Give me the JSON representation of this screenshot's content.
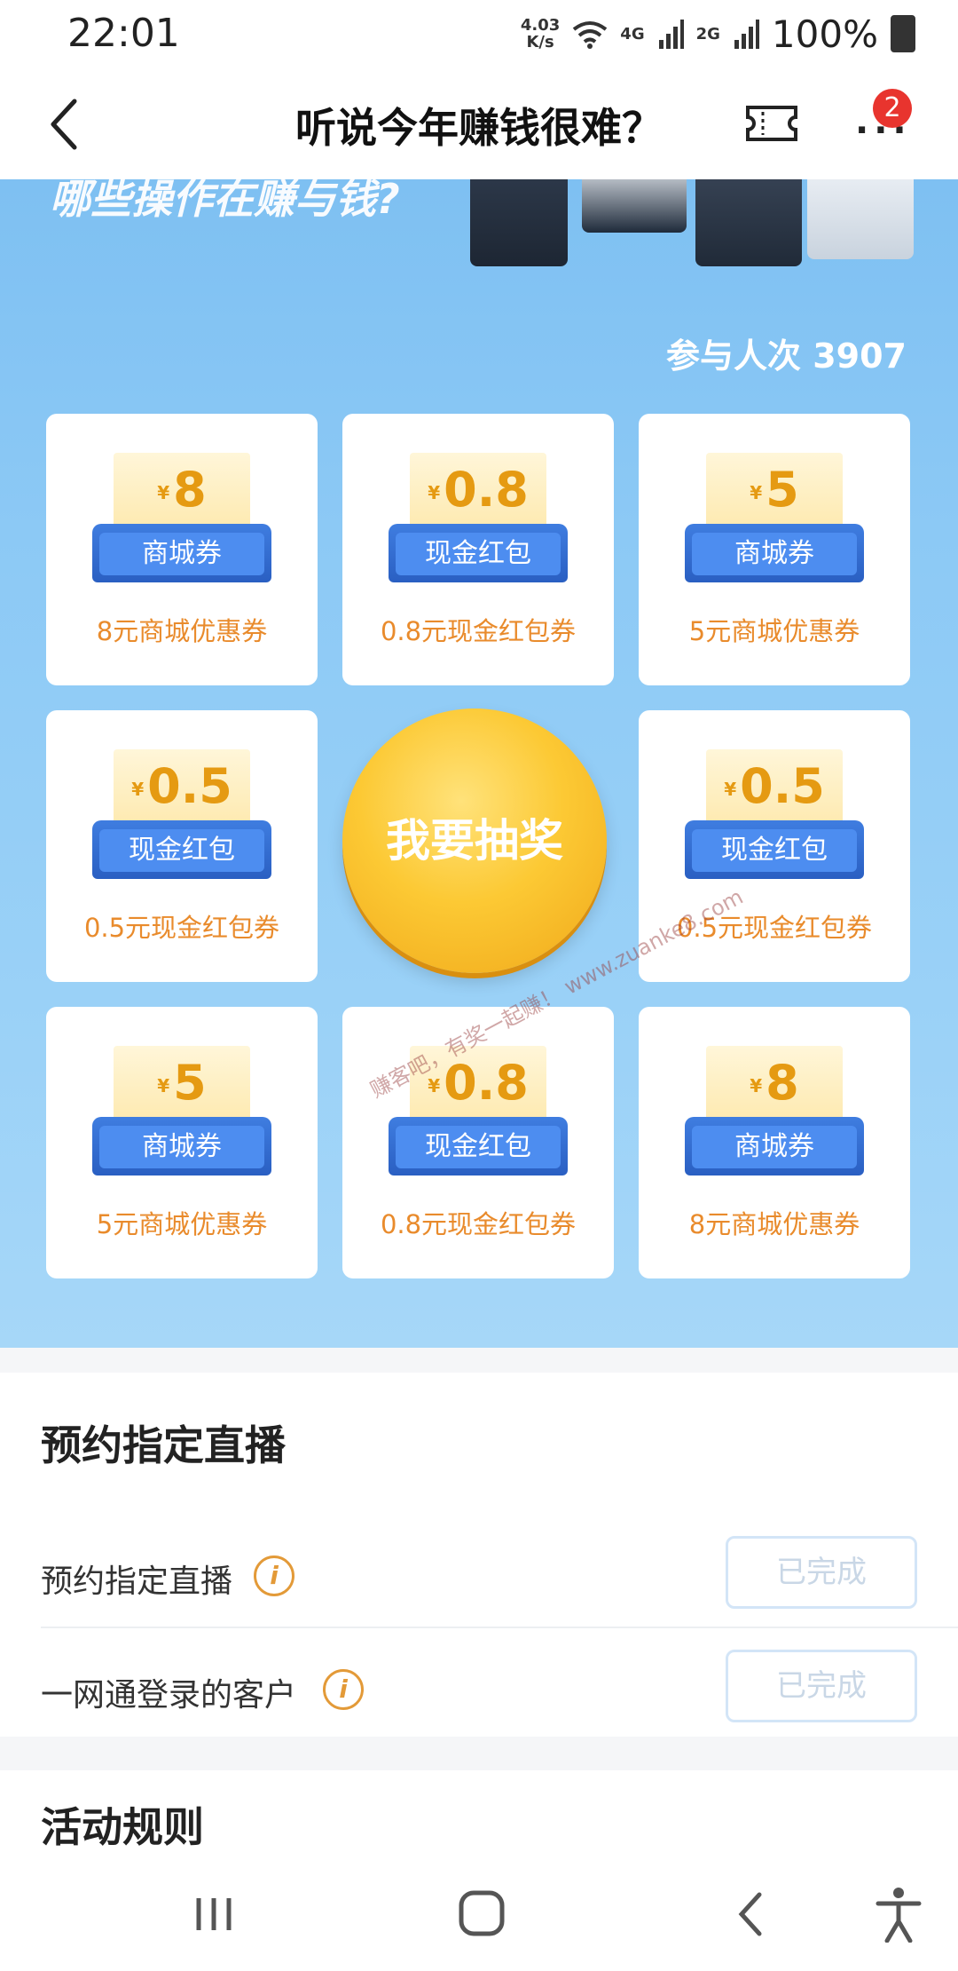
{
  "status_bar": {
    "time": "22:01",
    "net_speed_value": "4.03",
    "net_speed_unit": "K/s",
    "signal_1": "4G",
    "signal_2": "2G",
    "battery": "100%"
  },
  "header": {
    "title": "听说今年赚钱很难？",
    "notification_count": "2"
  },
  "banner": {
    "headline": "哪些操作在赚与钱?",
    "participants": "参与人次 3907"
  },
  "prizes": [
    {
      "amount": "8",
      "coupon_label": "商城券",
      "name": "8元商城优惠券"
    },
    {
      "amount": "0.8",
      "coupon_label": "现金红包",
      "name": "0.8元现金红包券"
    },
    {
      "amount": "5",
      "coupon_label": "商城券",
      "name": "5元商城优惠券"
    },
    {
      "amount": "0.5",
      "coupon_label": "现金红包",
      "name": "0.5元现金红包券"
    },
    {
      "amount": "0.5",
      "coupon_label": "现金红包",
      "name": "0.5元现金红包券"
    },
    {
      "amount": "5",
      "coupon_label": "商城券",
      "name": "5元商城优惠券"
    },
    {
      "amount": "0.8",
      "coupon_label": "现金红包",
      "name": "0.8元现金红包券"
    },
    {
      "amount": "8",
      "coupon_label": "商城券",
      "name": "8元商城优惠券"
    }
  ],
  "draw_button": "我要抽奖",
  "watermark": "赚客吧，有奖一起赚！ www.zuanke8.com",
  "currency_symbol": "¥",
  "tasks": {
    "title": "预约指定直播",
    "items": [
      {
        "name": "预约指定直播",
        "status": "已完成"
      },
      {
        "name": "一网通登录的客户",
        "status": "已完成"
      }
    ]
  },
  "rules": {
    "title": "活动规则"
  },
  "colors": {
    "banner_blue": "#8cc9f5",
    "label_orange": "#e98b2c",
    "draw_gold": "#fcc934",
    "badge_red": "#e8342e"
  }
}
